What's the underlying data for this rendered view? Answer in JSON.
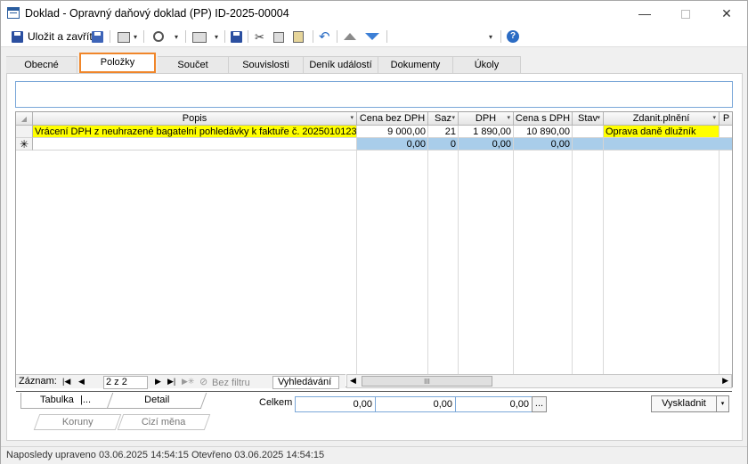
{
  "window": {
    "title": "Doklad - Opravný daňový doklad (PP) ID-2025-00004",
    "minimize": "—",
    "close": "✕"
  },
  "toolbar": {
    "save_close_label": "Uložit a zavřít",
    "dropdown_glyph": "▾"
  },
  "tabs": [
    {
      "label": "Obecné",
      "active": false
    },
    {
      "label": "Položky",
      "active": true
    },
    {
      "label": "Součet",
      "active": false
    },
    {
      "label": "Souvislosti",
      "active": false
    },
    {
      "label": "Deník událostí",
      "active": false
    },
    {
      "label": "Dokumenty",
      "active": false
    },
    {
      "label": "Úkoly",
      "active": false
    }
  ],
  "grid": {
    "columns": [
      "Popis",
      "Cena bez DPH",
      "Saz",
      "DPH",
      "Cena s DPH",
      "Stav",
      "Zdanit.plnění",
      "P"
    ],
    "rows": [
      {
        "popis": "Vrácení DPH z neuhrazené bagatelní pohledávky k faktuře č. 2025010123",
        "cena_bez_dph": "9 000,00",
        "saz": "21",
        "dph": "1 890,00",
        "cena_s_dph": "10 890,00",
        "stav": "",
        "zdanit_plneni": "Oprava daně dlužník"
      }
    ],
    "new_row": {
      "marker": "✳",
      "cena_bez_dph": "0,00",
      "saz": "0",
      "dph": "0,00",
      "cena_s_dph": "0,00"
    }
  },
  "record_nav": {
    "label": "Záznam:",
    "first": "|◀",
    "prev": "◀",
    "position": "2 z 2",
    "next": "▶",
    "last": "▶|",
    "new": "▶✳",
    "filter": "Bez filtru",
    "search": "Vyhledávání"
  },
  "scrollbar": {
    "left": "◀",
    "thumb": "III",
    "right": "▶"
  },
  "lower_tabs": {
    "tabulka": "Tabulka",
    "tabulka_suffix": "|...",
    "detail": "Detail",
    "koruny": "Koruny",
    "cizi_mena": "Cizí měna"
  },
  "totals": {
    "label": "Celkem",
    "values": [
      "0,00",
      "0,00",
      "0,00"
    ],
    "ellipsis": "..."
  },
  "buttons": {
    "vyskladnit": "Vyskladnit"
  },
  "status": {
    "text": "Naposledy upraveno 03.06.2025 14:54:15 Otevřeno 03.06.2025 14:54:15"
  }
}
